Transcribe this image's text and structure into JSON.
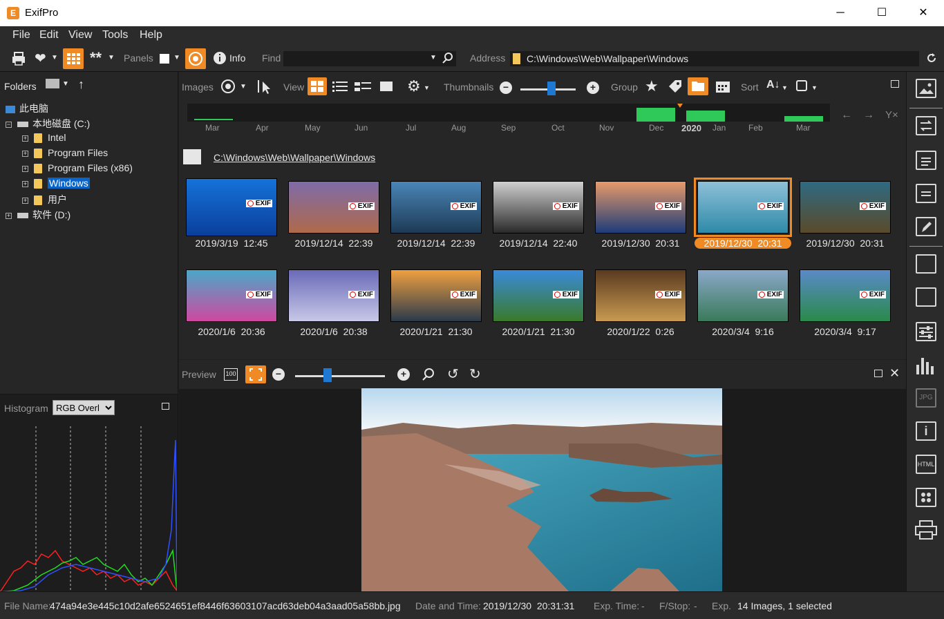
{
  "window": {
    "title": "ExifPro",
    "logo_letter": "E"
  },
  "menu": [
    "File",
    "Edit",
    "View",
    "Tools",
    "Help"
  ],
  "toolbar": {
    "panels_label": "Panels",
    "info_label": "Info",
    "find_label": "Find",
    "find_value": "",
    "address_label": "Address",
    "address_value": "C:\\Windows\\Web\\Wallpaper\\Windows",
    "stars_label": "**"
  },
  "folders": {
    "title": "Folders",
    "tree": [
      {
        "label": "此电脑",
        "level": 0,
        "icon": "computer-icon"
      },
      {
        "label": "本地磁盘 (C:)",
        "level": 0,
        "icon": "drive-icon",
        "expander": "⊟"
      },
      {
        "label": "Intel",
        "level": 1,
        "icon": "folder-icon",
        "expander": "⊞"
      },
      {
        "label": "Program Files",
        "level": 1,
        "icon": "folder-icon",
        "expander": "⊞"
      },
      {
        "label": "Program Files (x86)",
        "level": 1,
        "icon": "folder-icon",
        "expander": "⊞"
      },
      {
        "label": "Windows",
        "level": 1,
        "icon": "folder-icon",
        "expander": "⊞",
        "selected": true
      },
      {
        "label": "用户",
        "level": 1,
        "icon": "folder-icon",
        "expander": "⊞"
      },
      {
        "label": "软件 (D:)",
        "level": 0,
        "icon": "drive-icon",
        "expander": "⊞"
      }
    ]
  },
  "histogram": {
    "title": "Histogram",
    "mode": "RGB Overl"
  },
  "images_panel": {
    "images_label": "Images",
    "view_label": "View",
    "thumbnails_label": "Thumbnails",
    "group_label": "Group",
    "sort_label": "Sort",
    "thumbnail_size": 0.55,
    "timeline_months": [
      "Mar",
      "Apr",
      "May",
      "Jun",
      "Jul",
      "Aug",
      "Sep",
      "Oct",
      "Nov",
      "Dec",
      "Jan",
      "Feb",
      "Mar"
    ],
    "timeline_year": "2020",
    "path": "C:\\Windows\\Web\\Wallpaper\\Windows",
    "exif_badge": "EXIF",
    "thumbnails": [
      {
        "caption": "2019/3/19  12:45",
        "c1": "#1572d8",
        "c2": "#0a3f9c"
      },
      {
        "caption": "2019/12/14  22:39",
        "c1": "#7e6ba8",
        "c2": "#b06a4a"
      },
      {
        "caption": "2019/12/14  22:39",
        "c1": "#4a86b8",
        "c2": "#1d3a55"
      },
      {
        "caption": "2019/12/14  22:40",
        "c1": "#cfcfcf",
        "c2": "#2a2a2a"
      },
      {
        "caption": "2019/12/30  20:31",
        "c1": "#e89a6a",
        "c2": "#1d3c78"
      },
      {
        "caption": "2019/12/30  20:31",
        "c1": "#8fc0d8",
        "c2": "#2e8aa8",
        "selected": true
      },
      {
        "caption": "2019/12/30  20:31",
        "c1": "#2f6a82",
        "c2": "#5a4a2a"
      },
      {
        "caption": "2020/1/6  20:36",
        "c1": "#4aa8c8",
        "c2": "#d048a0"
      },
      {
        "caption": "2020/1/6  20:38",
        "c1": "#6a6ab8",
        "c2": "#c8c8e8"
      },
      {
        "caption": "2020/1/21  21:30",
        "c1": "#f0a040",
        "c2": "#2a3a4a"
      },
      {
        "caption": "2020/1/21  21:30",
        "c1": "#3a8ad8",
        "c2": "#3a7a2a"
      },
      {
        "caption": "2020/1/22  0:26",
        "c1": "#5a3a20",
        "c2": "#c89a50"
      },
      {
        "caption": "2020/3/4  9:16",
        "c1": "#8aa8c8",
        "c2": "#3a7a5a"
      },
      {
        "caption": "2020/3/4  9:17",
        "c1": "#5a8ac8",
        "c2": "#2a8a4a"
      }
    ]
  },
  "preview": {
    "label": "Preview",
    "zoom_100": "100",
    "zoom_level": 0.35
  },
  "statusbar": {
    "file_name_label": "File Name:",
    "file_name": "474a94e3e445c10d2afe6524651ef8446f63603107acd63deb04a3aad05a58bb.jpg",
    "date_label": "Date and Time:",
    "date_value": "2019/12/30  20:31:31",
    "exp_time_label": "Exp. Time:",
    "exp_time_value": "-",
    "fstop_label": "F/Stop:",
    "fstop_value": "-",
    "exp_label": "Exp.",
    "count": "14 Images, 1 selected"
  },
  "right_panel": {
    "jpg_label": "JPG",
    "html_label": "HTML",
    "info_glyph": "i"
  },
  "colors": {
    "accent": "#f08a24",
    "selection": "#0a64c8",
    "panel": "#262626"
  }
}
